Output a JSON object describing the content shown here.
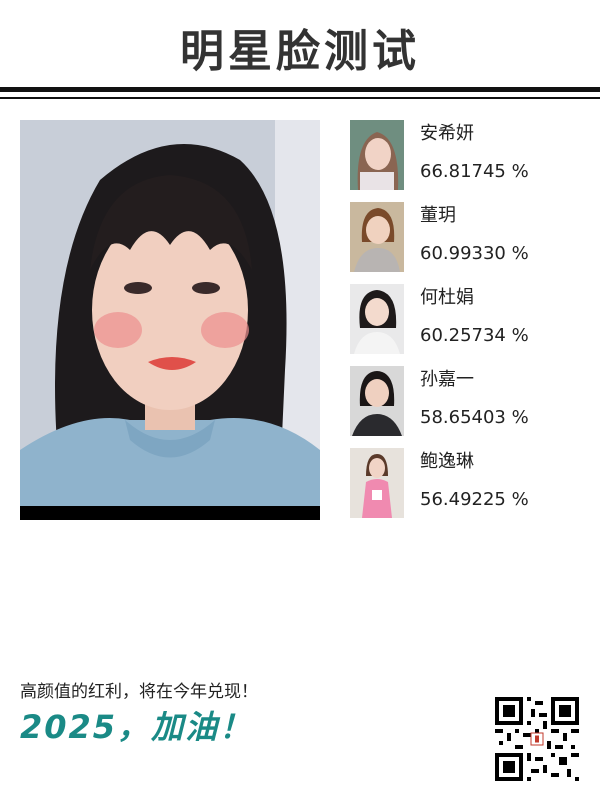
{
  "header": {
    "title": "明星脸测试"
  },
  "main": {
    "portrait_alt": "uploaded face photo",
    "matches": [
      {
        "name": "安希妍",
        "score": "66.81745 %"
      },
      {
        "name": "董玥",
        "score": "60.99330 %"
      },
      {
        "name": "何杜娟",
        "score": "60.25734 %"
      },
      {
        "name": "孙嘉一",
        "score": "58.65403 %"
      },
      {
        "name": "鲍逸琳",
        "score": "56.49225 %"
      }
    ]
  },
  "footer": {
    "message": "高颜值的红利，将在今年兑现！",
    "slogan": "2025，加油！"
  },
  "colors": {
    "slogan": "#1a8a86",
    "rule": "#111111",
    "title": "#333333"
  },
  "icons": {
    "qr": "qr-code-icon"
  }
}
